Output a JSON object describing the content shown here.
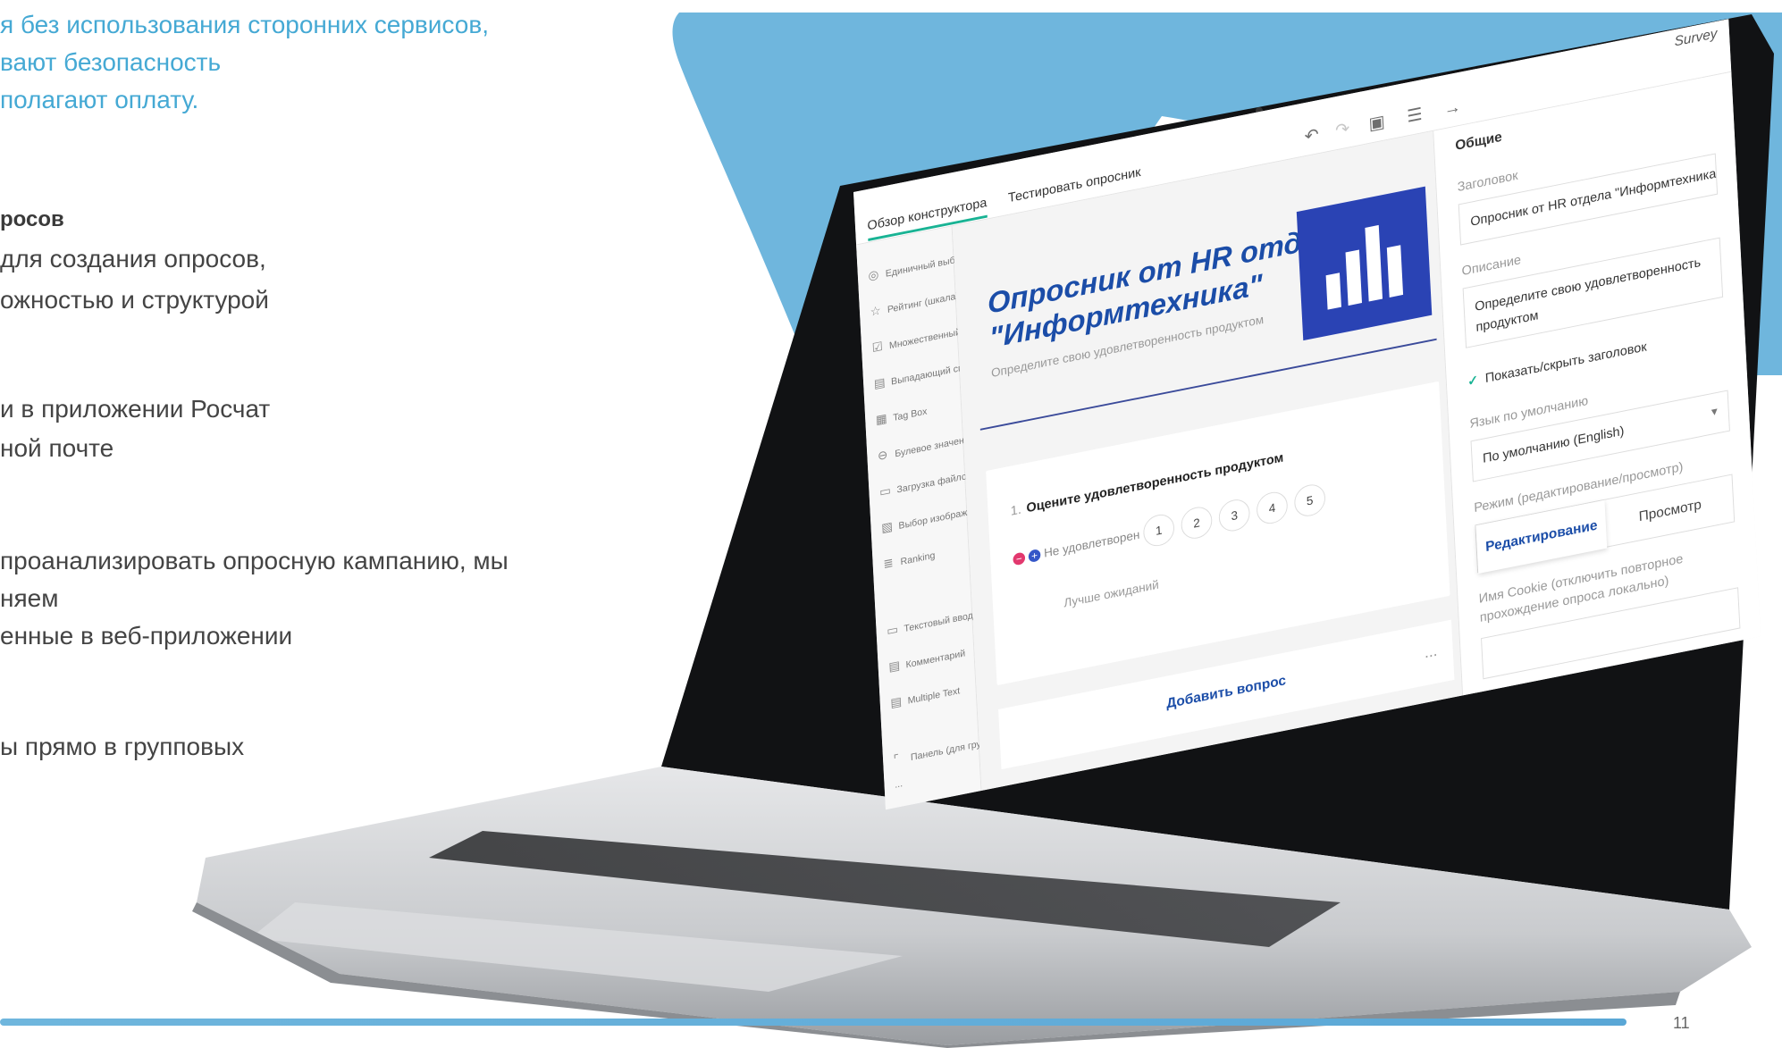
{
  "slide": {
    "intro_lines": [
      "я без использования сторонних сервисов,",
      "вают безопасность",
      "полагают оплату."
    ],
    "section_title": "росов",
    "body_blocks": [
      [
        "для создания опросов,",
        "ожностью и структурой"
      ],
      [
        "и в приложении Росчат",
        "ной почте"
      ],
      [
        "проанализировать опросную кампанию, мы",
        "няем",
        "енные в веб-приложении"
      ],
      [
        "ы прямо в групповых"
      ]
    ],
    "page_number": "11"
  },
  "colors": {
    "accent_blue": "#6fb6dd",
    "title_blue": "#1b4da8",
    "logo_blue": "#2a43b4",
    "intro_text": "#45a9d4"
  },
  "app": {
    "tabs": [
      "Обзор конструктора",
      "Тестировать опросник"
    ],
    "brand": "Survey",
    "toolbar_icons": [
      "undo-icon",
      "redo-icon",
      "save-icon",
      "settings-icon",
      "collapse-panel-icon"
    ],
    "toolbox": [
      {
        "icon": "radio-icon",
        "label": "Единичный выбор"
      },
      {
        "icon": "star-icon",
        "label": "Рейтинг (шкала)"
      },
      {
        "icon": "checkbox-icon",
        "label": "Множественный выбор"
      },
      {
        "icon": "dropdown-icon",
        "label": "Выпадающий список"
      },
      {
        "icon": "tagbox-icon",
        "label": "Tag Box"
      },
      {
        "icon": "boolean-icon",
        "label": "Булевое значение"
      },
      {
        "icon": "file-icon",
        "label": "Загрузка файлов"
      },
      {
        "icon": "image-icon",
        "label": "Выбор изображения"
      },
      {
        "icon": "ranking-icon",
        "label": "Ranking"
      },
      {
        "icon": "text-icon",
        "label": "Текстовый ввод"
      },
      {
        "icon": "comment-icon",
        "label": "Комментарий"
      },
      {
        "icon": "multitext-icon",
        "label": "Multiple Text"
      },
      {
        "icon": "panel-icon",
        "label": "Панель (для группы вопросов)"
      }
    ],
    "toolbox_more": "...",
    "survey": {
      "title_line1": "Опросник от HR отдела",
      "title_line2": "\"Информтехника\"",
      "description": "Определите свою удовлетворенность продуктом"
    },
    "question": {
      "number": "1.",
      "title": "Оцените удовлетворенность продуктом",
      "min_label": "Не удовлетворен",
      "max_label": "Лучше ожиданий",
      "rates": [
        "1",
        "2",
        "3",
        "4",
        "5"
      ]
    },
    "add_question": "Добавить вопрос",
    "add_question_more": "...",
    "properties": {
      "header": "Общие",
      "title_label": "Заголовок",
      "title_value": "Опросник от HR отдела \"Информтехника\"",
      "description_label": "Описание",
      "description_value": "Определите свою удовлетворенность продуктом",
      "show_title_label": "Показать/скрыть заголовок",
      "language_label": "Язык по умолчанию",
      "language_value": "По умолчанию (English)",
      "mode_label": "Режим (редактирование/просмотр)",
      "mode_edit": "Редактирование",
      "mode_view": "Просмотр",
      "cookie_label": "Имя Cookie (отключить повторное прохождение опроса локально)"
    }
  }
}
